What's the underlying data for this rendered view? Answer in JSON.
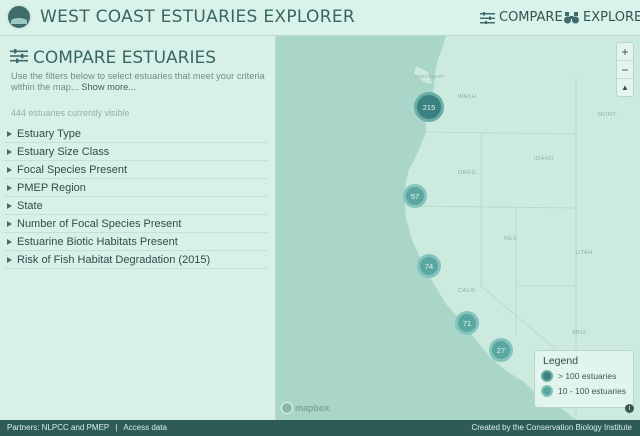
{
  "header": {
    "title": "WEST COAST ESTUARIES EXPLORER",
    "nav": {
      "compare": "COMPARE",
      "explore": "EXPLORE"
    }
  },
  "sidebar": {
    "title": "COMPARE ESTUARIES",
    "description": "Use the filters below to select estuaries that meet your criteria within the map...",
    "show_more": "Show more...",
    "visible_count": "444 estuaries currently visible",
    "filters": [
      "Estuary Type",
      "Estuary Size Class",
      "Focal Species Present",
      "PMEP Region",
      "State",
      "Number of Focal Species Present",
      "Estuarine Biotic Habitats Present",
      "Risk of Fish Habitat Degradation (2015)"
    ]
  },
  "map": {
    "clusters": [
      {
        "count": "215",
        "size": "large"
      },
      {
        "count": "57",
        "size": "medium"
      },
      {
        "count": "74",
        "size": "medium"
      },
      {
        "count": "71",
        "size": "medium"
      },
      {
        "count": "27",
        "size": "medium"
      }
    ],
    "labels": [
      "WASH.",
      "OREG.",
      "IDAHO",
      "MONT.",
      "NEV.",
      "UTAH",
      "CALIF.",
      "ARIZ.",
      "Vancouver"
    ],
    "zoom": {
      "in": "+",
      "out": "−",
      "reset": "▲"
    },
    "legend": {
      "title": "Legend",
      "items": [
        "> 100 estuaries",
        "10 - 100 estuaries"
      ]
    },
    "attribution": "mapbox",
    "info": "i"
  },
  "footer": {
    "partners": "Partners: NLPCC and PMEP",
    "access": "Access data",
    "credit": "Created by the Conservation Biology Institute"
  },
  "colors": {
    "cluster_large": "#3c8181",
    "cluster_medium": "#5aa6a0",
    "footer": "#2f5b57",
    "ocean": "#a9d6c8",
    "land": "#cdeade"
  }
}
